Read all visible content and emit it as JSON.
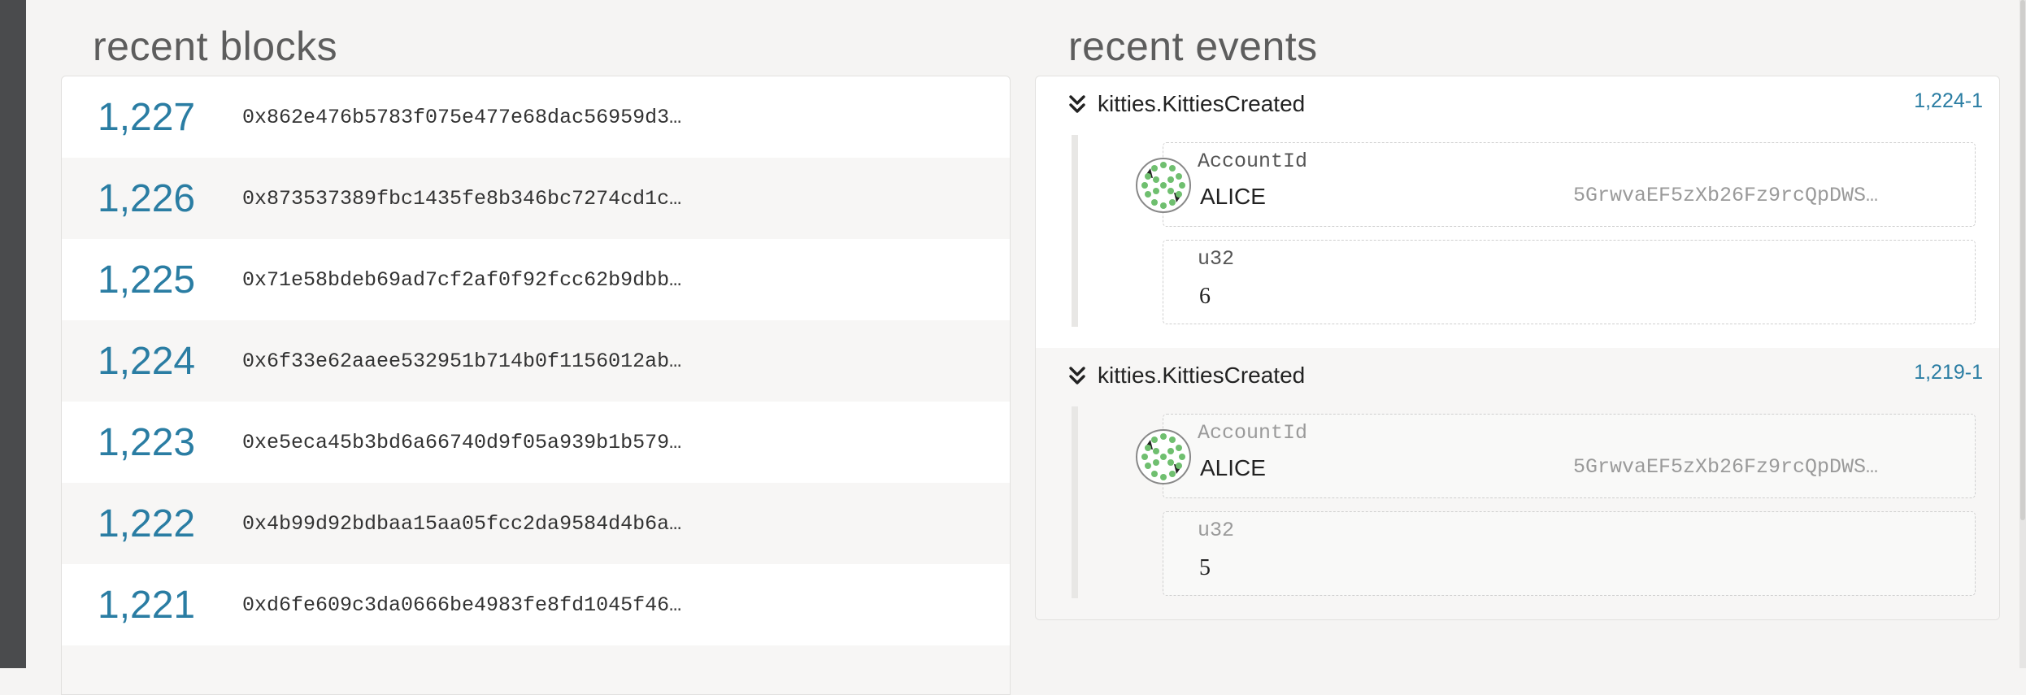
{
  "blocks": {
    "title": "recent blocks",
    "items": [
      {
        "number": "1,227",
        "hash": "0x862e476b5783f075e477e68dac56959d3…"
      },
      {
        "number": "1,226",
        "hash": "0x873537389fbc1435fe8b346bc7274cd1c…"
      },
      {
        "number": "1,225",
        "hash": "0x71e58bdeb69ad7cf2af0f92fcc62b9dbb…"
      },
      {
        "number": "1,224",
        "hash": "0x6f33e62aaee532951b714b0f1156012ab…"
      },
      {
        "number": "1,223",
        "hash": "0xe5eca45b3bd6a66740d9f05a939b1b579…"
      },
      {
        "number": "1,222",
        "hash": "0x4b99d92bdbaa15aa05fcc2da9584d4b6a…"
      },
      {
        "number": "1,221",
        "hash": "0xd6fe609c3da0666be4983fe8fd1045f46…"
      }
    ]
  },
  "events": {
    "title": "recent events",
    "items": [
      {
        "name": "kitties.KittiesCreated",
        "id": "1,224-1",
        "account_type": "AccountId",
        "account_name": "ALICE",
        "account_address": "5GrwvaEF5zXb26Fz9rcQpDWS…",
        "value_type": "u32",
        "value": "6"
      },
      {
        "name": "kitties.KittiesCreated",
        "id": "1,219-1",
        "account_type": "AccountId",
        "account_name": "ALICE",
        "account_address": "5GrwvaEF5zXb26Fz9rcQpDWS…",
        "value_type": "u32",
        "value": "5"
      }
    ]
  },
  "colors": {
    "accent": "#2a7da3",
    "identicon_green": "#6fbf6f",
    "sidebar": "#4a4b4d"
  },
  "icons": {
    "expand": "double-chevron-down-icon",
    "identity": "identicon"
  }
}
